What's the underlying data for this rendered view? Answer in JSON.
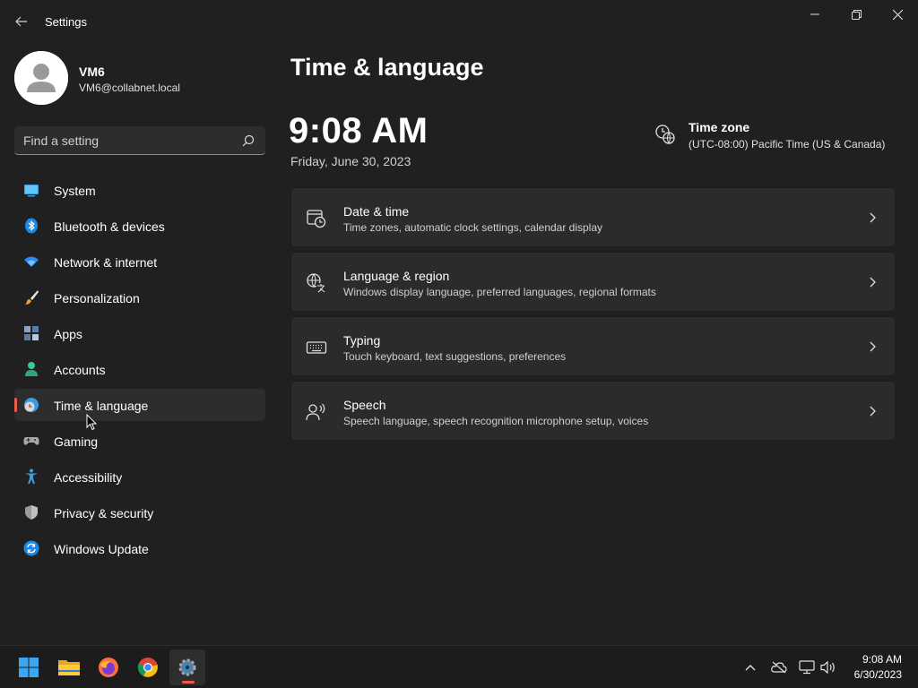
{
  "window": {
    "title": "Settings"
  },
  "profile": {
    "name": "VM6",
    "email": "VM6@collabnet.local"
  },
  "search": {
    "placeholder": "Find a setting"
  },
  "sidebar": {
    "items": [
      {
        "label": "System",
        "icon": "system-icon"
      },
      {
        "label": "Bluetooth & devices",
        "icon": "bluetooth-icon"
      },
      {
        "label": "Network & internet",
        "icon": "wifi-icon"
      },
      {
        "label": "Personalization",
        "icon": "paintbrush-icon"
      },
      {
        "label": "Apps",
        "icon": "apps-icon"
      },
      {
        "label": "Accounts",
        "icon": "accounts-icon"
      },
      {
        "label": "Time & language",
        "icon": "time-language-icon",
        "selected": true
      },
      {
        "label": "Gaming",
        "icon": "gamepad-icon"
      },
      {
        "label": "Accessibility",
        "icon": "accessibility-icon"
      },
      {
        "label": "Privacy & security",
        "icon": "shield-icon"
      },
      {
        "label": "Windows Update",
        "icon": "update-icon"
      }
    ]
  },
  "main": {
    "title": "Time & language",
    "time": "9:08 AM",
    "date": "Friday, June 30, 2023",
    "timezone_label": "Time zone",
    "timezone_value": "(UTC-08:00) Pacific Time (US & Canada)",
    "cards": [
      {
        "title": "Date & time",
        "subtitle": "Time zones, automatic clock settings, calendar display",
        "icon": "calendar-clock-icon"
      },
      {
        "title": "Language & region",
        "subtitle": "Windows display language, preferred languages, regional formats",
        "icon": "language-icon"
      },
      {
        "title": "Typing",
        "subtitle": "Touch keyboard, text suggestions, preferences",
        "icon": "keyboard-icon"
      },
      {
        "title": "Speech",
        "subtitle": "Speech language, speech recognition microphone setup, voices",
        "icon": "speech-icon"
      }
    ]
  },
  "taskbar": {
    "apps": [
      "start-icon",
      "file-explorer-icon",
      "firefox-icon",
      "chrome-icon",
      "settings-icon"
    ],
    "active_app": "settings-icon",
    "time": "9:08 AM",
    "date": "6/30/2023"
  },
  "colors": {
    "background": "#202020",
    "card": "#2b2b2b",
    "accent": "#f05a4a",
    "text": "#ffffff"
  }
}
